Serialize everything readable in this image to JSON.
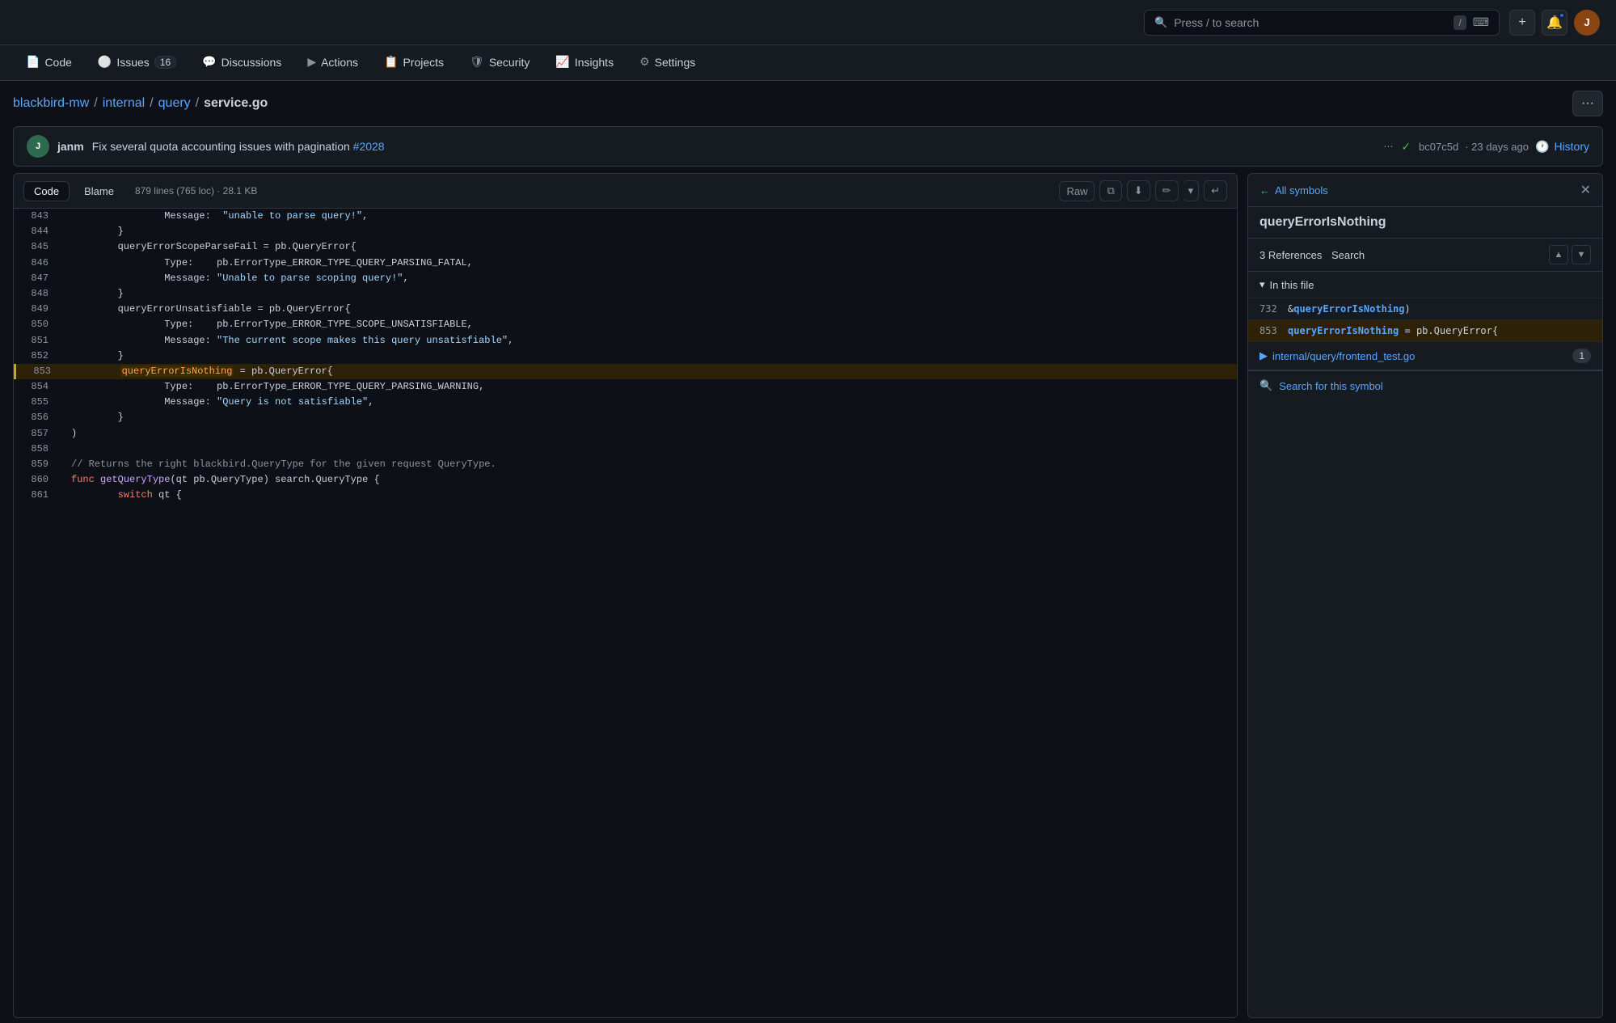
{
  "topbar": {
    "search_placeholder": "Press / to search",
    "search_kbd": "/",
    "add_btn": "+",
    "notification_btn": "🔔"
  },
  "nav": {
    "tabs": [
      {
        "id": "code",
        "label": "Code",
        "icon": "📄",
        "badge": null,
        "active": false
      },
      {
        "id": "issues",
        "label": "Issues",
        "icon": "⚪",
        "badge": "16",
        "active": false
      },
      {
        "id": "discussions",
        "label": "Discussions",
        "icon": "💬",
        "badge": null,
        "active": false
      },
      {
        "id": "actions",
        "label": "Actions",
        "icon": "▶",
        "badge": null,
        "active": false
      },
      {
        "id": "projects",
        "label": "Projects",
        "icon": "📋",
        "badge": null,
        "active": false
      },
      {
        "id": "security",
        "label": "Security",
        "icon": "🛡",
        "badge": null,
        "active": false
      },
      {
        "id": "insights",
        "label": "Insights",
        "icon": "📈",
        "badge": null,
        "active": false
      },
      {
        "id": "settings",
        "label": "Settings",
        "icon": "⚙",
        "badge": null,
        "active": false
      }
    ]
  },
  "breadcrumb": {
    "parts": [
      {
        "label": "blackbird-mw",
        "link": true
      },
      {
        "label": "/",
        "link": false
      },
      {
        "label": "internal",
        "link": true
      },
      {
        "label": "/",
        "link": false
      },
      {
        "label": "query",
        "link": true
      },
      {
        "label": "/",
        "link": false
      },
      {
        "label": "service.go",
        "link": false
      }
    ]
  },
  "commit": {
    "user": "janm",
    "message": "Fix several quota accounting issues with pagination",
    "pr": "#2028",
    "hash": "bc07c5d",
    "time_ago": "23 days ago",
    "status": "✓",
    "history_label": "History"
  },
  "code_toolbar": {
    "code_tab": "Code",
    "blame_tab": "Blame",
    "meta": "879 lines (765 loc) · 28.1 KB",
    "raw_btn": "Raw",
    "copy_btn": "⧉",
    "download_btn": "⬇",
    "edit_btn": "✏",
    "more_btn": "▾",
    "wrap_btn": "↵"
  },
  "code_lines": [
    {
      "num": 843,
      "content": "                Message:  \"unable to parse query!\",",
      "highlighted": false
    },
    {
      "num": 844,
      "content": "        }",
      "highlighted": false
    },
    {
      "num": 845,
      "content": "        queryErrorScopeParseFail = pb.QueryError{",
      "highlighted": false
    },
    {
      "num": 846,
      "content": "                Type:    pb.ErrorType_ERROR_TYPE_QUERY_PARSING_FATAL,",
      "highlighted": false
    },
    {
      "num": 847,
      "content": "                Message: \"Unable to parse scoping query!\",",
      "highlighted": false
    },
    {
      "num": 848,
      "content": "        }",
      "highlighted": false
    },
    {
      "num": 849,
      "content": "        queryErrorUnsatisfiable = pb.QueryError{",
      "highlighted": false
    },
    {
      "num": 850,
      "content": "                Type:    pb.ErrorType_ERROR_TYPE_SCOPE_UNSATISFIABLE,",
      "highlighted": false
    },
    {
      "num": 851,
      "content": "                Message: \"The current scope makes this query unsatisfiable\",",
      "highlighted": false
    },
    {
      "num": 852,
      "content": "        }",
      "highlighted": false
    },
    {
      "num": 853,
      "content": "        queryErrorIsNothing = pb.QueryError{",
      "highlighted": true
    },
    {
      "num": 854,
      "content": "                Type:    pb.ErrorType_ERROR_TYPE_QUERY_PARSING_WARNING,",
      "highlighted": false
    },
    {
      "num": 855,
      "content": "                Message: \"Query is not satisfiable\",",
      "highlighted": false
    },
    {
      "num": 856,
      "content": "        }",
      "highlighted": false
    },
    {
      "num": 857,
      "content": ")",
      "highlighted": false
    },
    {
      "num": 858,
      "content": "",
      "highlighted": false
    },
    {
      "num": 859,
      "content": "// Returns the right blackbird.QueryType for the given request QueryType.",
      "highlighted": false
    },
    {
      "num": 860,
      "content": "func getQueryType(qt pb.QueryType) search.QueryType {",
      "highlighted": false
    },
    {
      "num": 861,
      "content": "        switch qt {",
      "highlighted": false
    }
  ],
  "symbols_panel": {
    "back_label": "All symbols",
    "symbol_name": "queryErrorIsNothing",
    "refs_count": "3 References",
    "search_label": "Search",
    "in_this_file_label": "In this file",
    "refs": [
      {
        "line": "732",
        "code": "&queryErrorIsNothing)",
        "highlight": "queryErrorIsNothing",
        "active": false
      },
      {
        "line": "853",
        "code": "queryErrorIsNothing = pb.QueryError{",
        "highlight": "queryErrorIsNothing",
        "active": true
      }
    ],
    "external_file": {
      "name": "internal/query/frontend_test.go",
      "count": "1"
    },
    "search_symbol_label": "Search for this symbol"
  }
}
